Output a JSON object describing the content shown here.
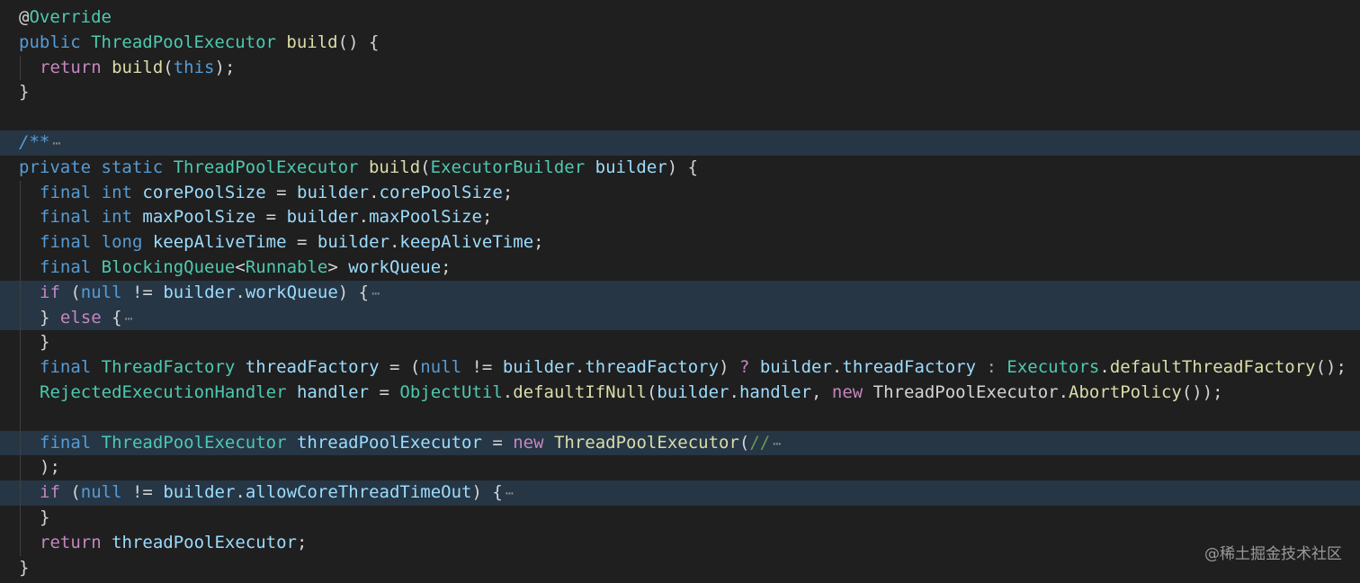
{
  "editor": {
    "theme_background": "#1f1f1f",
    "folded_highlight": "#263645",
    "lines": [
      {
        "indent": 0,
        "folded": false,
        "tokens": [
          [
            "at",
            "@"
          ],
          [
            "ann",
            "Override"
          ]
        ]
      },
      {
        "indent": 0,
        "folded": false,
        "tokens": [
          [
            "kw",
            "public "
          ],
          [
            "type",
            "ThreadPoolExecutor "
          ],
          [
            "fn",
            "build"
          ],
          [
            "plain",
            "() {"
          ]
        ]
      },
      {
        "indent": 1,
        "folded": false,
        "tokens": [
          [
            "ctrl",
            "return "
          ],
          [
            "fn",
            "build"
          ],
          [
            "plain",
            "("
          ],
          [
            "kw",
            "this"
          ],
          [
            "plain",
            ");"
          ]
        ]
      },
      {
        "indent": 0,
        "folded": false,
        "tokens": [
          [
            "plain",
            "}"
          ]
        ]
      },
      {
        "indent": 0,
        "folded": false,
        "tokens": []
      },
      {
        "indent": 0,
        "folded": true,
        "tokens": [
          [
            "doc",
            "/**"
          ]
        ],
        "ellipsis": true
      },
      {
        "indent": 0,
        "folded": false,
        "tokens": [
          [
            "kw",
            "private static "
          ],
          [
            "type",
            "ThreadPoolExecutor "
          ],
          [
            "fn",
            "build"
          ],
          [
            "plain",
            "("
          ],
          [
            "type",
            "ExecutorBuilder "
          ],
          [
            "var",
            "builder"
          ],
          [
            "plain",
            ") {"
          ]
        ]
      },
      {
        "indent": 1,
        "folded": false,
        "tokens": [
          [
            "kw",
            "final int "
          ],
          [
            "var",
            "corePoolSize "
          ],
          [
            "plain",
            "= "
          ],
          [
            "var",
            "builder"
          ],
          [
            "plain",
            "."
          ],
          [
            "var",
            "corePoolSize"
          ],
          [
            "plain",
            ";"
          ]
        ]
      },
      {
        "indent": 1,
        "folded": false,
        "tokens": [
          [
            "kw",
            "final int "
          ],
          [
            "var",
            "maxPoolSize "
          ],
          [
            "plain",
            "= "
          ],
          [
            "var",
            "builder"
          ],
          [
            "plain",
            "."
          ],
          [
            "var",
            "maxPoolSize"
          ],
          [
            "plain",
            ";"
          ]
        ]
      },
      {
        "indent": 1,
        "folded": false,
        "tokens": [
          [
            "kw",
            "final long "
          ],
          [
            "var",
            "keepAliveTime "
          ],
          [
            "plain",
            "= "
          ],
          [
            "var",
            "builder"
          ],
          [
            "plain",
            "."
          ],
          [
            "var",
            "keepAliveTime"
          ],
          [
            "plain",
            ";"
          ]
        ]
      },
      {
        "indent": 1,
        "folded": false,
        "tokens": [
          [
            "kw",
            "final "
          ],
          [
            "type",
            "BlockingQueue"
          ],
          [
            "plain",
            "<"
          ],
          [
            "type",
            "Runnable"
          ],
          [
            "plain",
            "> "
          ],
          [
            "var",
            "workQueue"
          ],
          [
            "plain",
            ";"
          ]
        ]
      },
      {
        "indent": 1,
        "folded": true,
        "tokens": [
          [
            "ctrl",
            "if "
          ],
          [
            "plain",
            "("
          ],
          [
            "kw",
            "null "
          ],
          [
            "plain",
            "!= "
          ],
          [
            "var",
            "builder"
          ],
          [
            "plain",
            "."
          ],
          [
            "var",
            "workQueue"
          ],
          [
            "plain",
            ") {"
          ]
        ],
        "ellipsis": true
      },
      {
        "indent": 1,
        "folded": true,
        "tokens": [
          [
            "plain",
            "} "
          ],
          [
            "ctrl",
            "else "
          ],
          [
            "plain",
            "{"
          ]
        ],
        "ellipsis": true
      },
      {
        "indent": 1,
        "folded": false,
        "tokens": [
          [
            "plain",
            "}"
          ]
        ]
      },
      {
        "indent": 1,
        "folded": false,
        "tokens": [
          [
            "kw",
            "final "
          ],
          [
            "type",
            "ThreadFactory "
          ],
          [
            "var",
            "threadFactory "
          ],
          [
            "plain",
            "= ("
          ],
          [
            "kw",
            "null "
          ],
          [
            "plain",
            "!= "
          ],
          [
            "var",
            "builder"
          ],
          [
            "plain",
            "."
          ],
          [
            "var",
            "threadFactory"
          ],
          [
            "plain",
            ") "
          ],
          [
            "ctrl",
            "? "
          ],
          [
            "var",
            "builder"
          ],
          [
            "plain",
            "."
          ],
          [
            "var",
            "threadFactory "
          ],
          [
            "ctrl",
            ": "
          ],
          [
            "type",
            "Executors"
          ],
          [
            "plain",
            "."
          ],
          [
            "fn",
            "defaultThreadFactory"
          ],
          [
            "plain",
            "();"
          ]
        ]
      },
      {
        "indent": 1,
        "folded": false,
        "tokens": [
          [
            "type",
            "RejectedExecutionHandler "
          ],
          [
            "var",
            "handler "
          ],
          [
            "plain",
            "= "
          ],
          [
            "type",
            "ObjectUtil"
          ],
          [
            "plain",
            "."
          ],
          [
            "fn",
            "defaultIfNull"
          ],
          [
            "plain",
            "("
          ],
          [
            "var",
            "builder"
          ],
          [
            "plain",
            "."
          ],
          [
            "var",
            "handler"
          ],
          [
            "plain",
            ", "
          ],
          [
            "ctrl",
            "new "
          ],
          [
            "plain",
            "ThreadPoolExecutor."
          ],
          [
            "fn",
            "AbortPolicy"
          ],
          [
            "plain",
            "());"
          ]
        ]
      },
      {
        "indent": 1,
        "folded": false,
        "tokens": []
      },
      {
        "indent": 1,
        "folded": true,
        "tokens": [
          [
            "kw",
            "final "
          ],
          [
            "type",
            "ThreadPoolExecutor "
          ],
          [
            "var",
            "threadPoolExecutor "
          ],
          [
            "plain",
            "= "
          ],
          [
            "ctrl",
            "new "
          ],
          [
            "fn",
            "ThreadPoolExecutor"
          ],
          [
            "plain",
            "("
          ],
          [
            "cmt",
            "//"
          ]
        ],
        "ellipsis": true
      },
      {
        "indent": 1,
        "folded": false,
        "tokens": [
          [
            "plain",
            ");"
          ]
        ]
      },
      {
        "indent": 1,
        "folded": true,
        "tokens": [
          [
            "ctrl",
            "if "
          ],
          [
            "plain",
            "("
          ],
          [
            "kw",
            "null "
          ],
          [
            "plain",
            "!= "
          ],
          [
            "var",
            "builder"
          ],
          [
            "plain",
            "."
          ],
          [
            "var",
            "allowCoreThreadTimeOut"
          ],
          [
            "plain",
            ") {"
          ]
        ],
        "ellipsis": true
      },
      {
        "indent": 1,
        "folded": false,
        "tokens": [
          [
            "plain",
            "}"
          ]
        ]
      },
      {
        "indent": 1,
        "folded": false,
        "tokens": [
          [
            "ctrl",
            "return "
          ],
          [
            "var",
            "threadPoolExecutor"
          ],
          [
            "plain",
            ";"
          ]
        ]
      },
      {
        "indent": 0,
        "folded": false,
        "tokens": [
          [
            "plain",
            "}"
          ]
        ]
      }
    ],
    "ellipsis_text": "⋯"
  },
  "watermark": "@稀土掘金技术社区"
}
